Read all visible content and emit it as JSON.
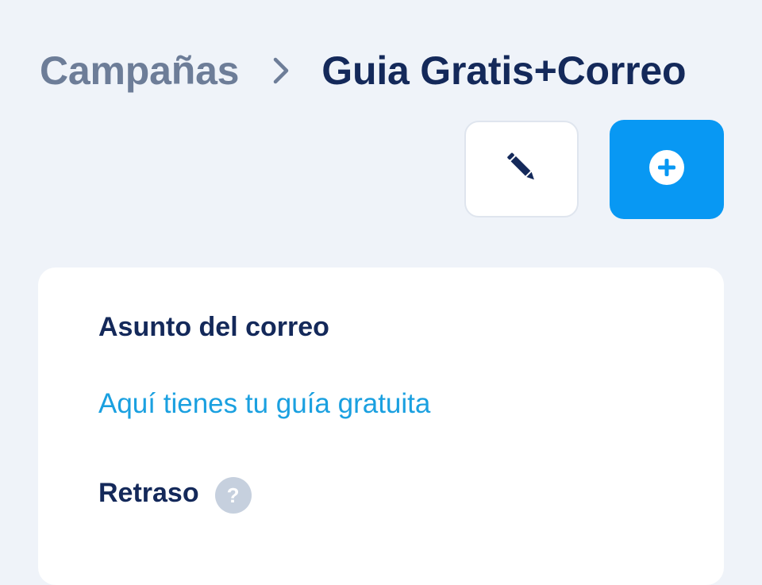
{
  "breadcrumb": {
    "parent": "Campañas",
    "separator_icon": "chevron-right-icon",
    "current": "Guia Gratis+Correo"
  },
  "toolbar": {
    "edit_icon": "pencil-icon",
    "add_icon": "plus-circle-icon",
    "add_color": "#0898f3"
  },
  "card": {
    "subject_label": "Asunto del correo",
    "subject_value": "Aquí tienes tu guía gratuita",
    "delay_label": "Retraso",
    "help_glyph": "?"
  },
  "colors": {
    "background": "#eff3f9",
    "primary_text": "#14295a",
    "muted_text": "#6d7d98",
    "link_text": "#1aa0e0"
  }
}
